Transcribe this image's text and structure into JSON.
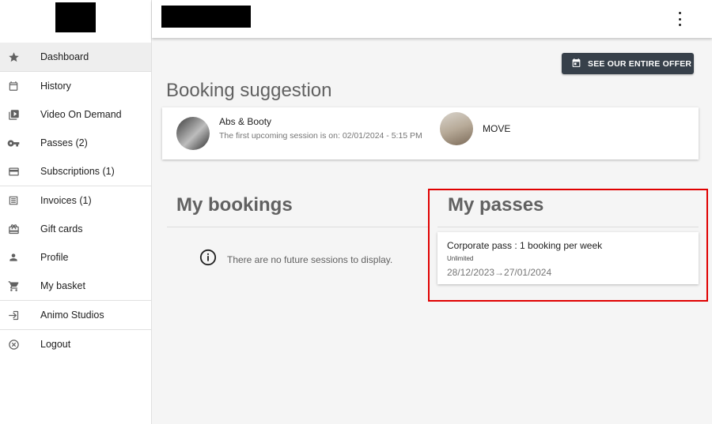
{
  "header": {
    "menu_icon": "more-vert-icon"
  },
  "sidebar": {
    "items": [
      {
        "label": "Dashboard",
        "icon": "star-icon",
        "active": true
      },
      {
        "label": "History",
        "icon": "calendar-icon"
      },
      {
        "label": "Video On Demand",
        "icon": "video-library-icon"
      },
      {
        "label": "Passes (2)",
        "icon": "key-icon"
      },
      {
        "label": "Subscriptions (1)",
        "icon": "credit-card-icon"
      },
      {
        "label": "Invoices (1)",
        "icon": "receipt-icon"
      },
      {
        "label": "Gift cards",
        "icon": "gift-card-icon"
      },
      {
        "label": "Profile",
        "icon": "person-icon"
      },
      {
        "label": "My basket",
        "icon": "cart-icon"
      },
      {
        "label": "Animo Studios",
        "icon": "login-icon"
      },
      {
        "label": "Logout",
        "icon": "close-circle-icon"
      }
    ]
  },
  "offer_button": {
    "label": "SEE OUR ENTIRE OFFER",
    "icon": "calendar-icon"
  },
  "suggestion": {
    "heading": "Booking suggestion",
    "items": [
      {
        "name": "Abs & Booty",
        "subtitle": "The first upcoming session is on: 02/01/2024 - 5:15 PM"
      },
      {
        "name": "MOVE"
      }
    ]
  },
  "bookings": {
    "heading": "My bookings",
    "empty_text": "There are no future sessions to display.",
    "empty_icon": "info-icon"
  },
  "passes": {
    "heading": "My passes",
    "items": [
      {
        "name": "Corporate pass : 1 booking per week",
        "type": "Unlimited",
        "dates": "28/12/2023→27/01/2024"
      }
    ]
  },
  "colors": {
    "accent": "#37404a",
    "highlight": "#e00000",
    "background": "#f5f5f5"
  }
}
